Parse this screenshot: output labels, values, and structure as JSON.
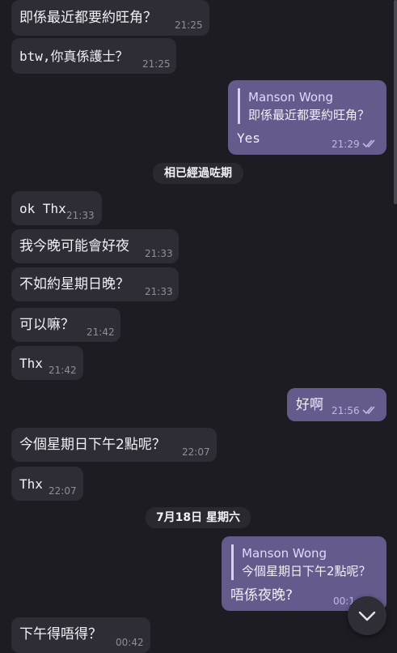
{
  "messages": [
    {
      "id": "m1",
      "text": "即係最近都要約旺角？",
      "time": "21:25",
      "dir": "in"
    },
    {
      "id": "m2",
      "text": "btw,你真係護士？",
      "time": "21:25",
      "dir": "in"
    },
    {
      "id": "m3",
      "reply_to": {
        "name": "Manson Wong",
        "text": "即係最近都要約旺角？"
      },
      "text": "Yes",
      "time": "21:29",
      "dir": "out",
      "read": true
    },
    {
      "id": "m4",
      "text": "ok Thx",
      "time": "21:33",
      "dir": "in"
    },
    {
      "id": "m5",
      "text": "我今晚可能會好夜",
      "time": "21:33",
      "dir": "in"
    },
    {
      "id": "m6",
      "text": "不如約星期日晚？",
      "time": "21:33",
      "dir": "in"
    },
    {
      "id": "m7",
      "text": "可以嘛？",
      "time": "21:42",
      "dir": "in"
    },
    {
      "id": "m8",
      "text": "Thx",
      "time": "21:42",
      "dir": "in"
    },
    {
      "id": "m9",
      "text": "好啊",
      "time": "21:56",
      "dir": "out",
      "read": true
    },
    {
      "id": "m10",
      "text": "今個星期日下午2點呢？",
      "time": "22:07",
      "dir": "in"
    },
    {
      "id": "m11",
      "text": "Thx",
      "time": "22:07",
      "dir": "in"
    },
    {
      "id": "m12",
      "reply_to": {
        "name": "Manson Wong",
        "text": "今個星期日下午2點呢？"
      },
      "text": "唔係夜晚?",
      "time": "00:1",
      "dir": "out",
      "read": true
    },
    {
      "id": "m13",
      "text": "下午得唔得？",
      "time": "00:42",
      "dir": "in"
    }
  ],
  "dates": {
    "d1": "相已經過咗期",
    "d2": "7月18日 星期六"
  },
  "icons": {
    "read_ticks": "double-check-icon",
    "scroll_down": "chevron-down-icon"
  },
  "colors": {
    "background": "#1d1c23",
    "incoming_bubble": "#2e2d35",
    "outgoing_bubble": "#645a8c"
  }
}
